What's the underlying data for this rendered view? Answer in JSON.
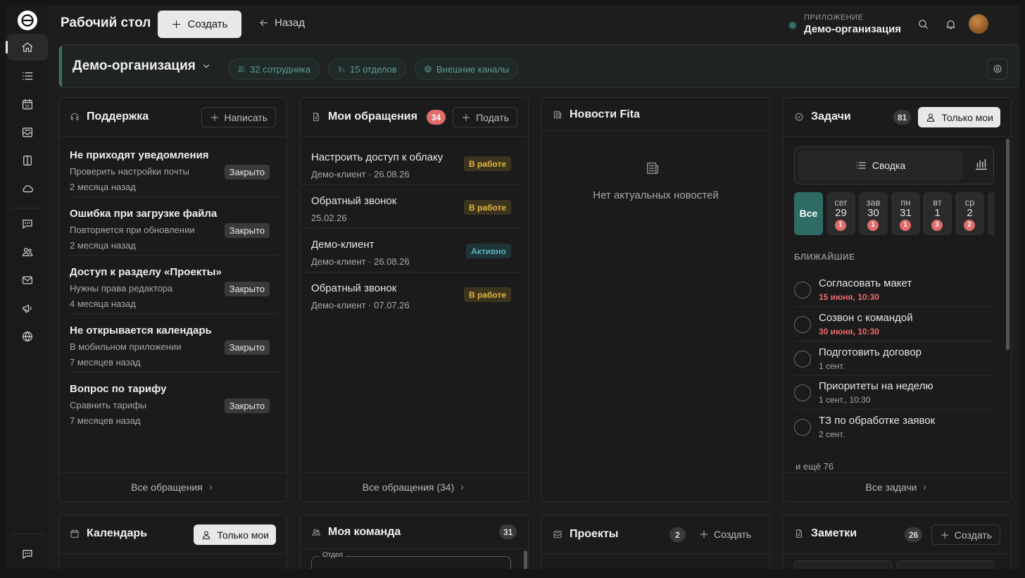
{
  "topbar": {
    "title": "Рабочий стол",
    "create_label": "Создать",
    "back_label": "Назад",
    "app_label": "ПРИЛОЖЕНИЕ",
    "app_name": "Демо-организация"
  },
  "org": {
    "title": "Демо-организация",
    "employees": "32 сотрудника",
    "departments": "15 отделов",
    "channels": "Внешние каналы"
  },
  "support": {
    "title": "Поддержка",
    "action": "Написать",
    "footer": "Все обращения",
    "items": [
      {
        "title": "Не приходят уведомления",
        "sub": "Проверить настройки почты",
        "time": "2 месяца назад",
        "status": "Закрыто"
      },
      {
        "title": "Ошибка при загрузке файла",
        "sub": "Повторяется при обновлении",
        "time": "2 месяца назад",
        "status": "Закрыто"
      },
      {
        "title": "Доступ к разделу «Проекты»",
        "sub": "Нужны права редактора",
        "time": "4 месяца назад",
        "status": "Закрыто"
      },
      {
        "title": "Не открывается календарь",
        "sub": "В мобильном приложении",
        "time": "7 месяцев назад",
        "status": "Закрыто"
      },
      {
        "title": "Вопрос по тарифу",
        "sub": "Сравнить тарифы",
        "time": "7 месяцев назад",
        "status": "Закрыто"
      }
    ]
  },
  "requests": {
    "title": "Мои обращения",
    "count": "34",
    "action": "Подать",
    "footer": "Все обращения (34)",
    "items": [
      {
        "title": "Настроить доступ к облаку",
        "sub": "Демо-клиент · 26.08.26",
        "status": "В работе"
      },
      {
        "title": "Обратный звонок",
        "sub": "25.02.26",
        "status": "В работе"
      },
      {
        "title": "Демо-клиент",
        "sub": "Демо-клиент · 26.08.26",
        "status": "Активно"
      },
      {
        "title": "Обратный звонок",
        "sub": "Демо-клиент · 07.07.26",
        "status": "В работе"
      }
    ]
  },
  "news": {
    "title": "Новости Fita",
    "empty": "Нет актуальных новостей"
  },
  "tasks": {
    "title": "Задачи",
    "count": "81",
    "filter": "Только мои",
    "summary": "Сводка",
    "all_label": "Все",
    "days": [
      {
        "name": "сег",
        "num": "29",
        "count": "1"
      },
      {
        "name": "зав",
        "num": "30",
        "count": "1"
      },
      {
        "name": "пн",
        "num": "31",
        "count": "1"
      },
      {
        "name": "вт",
        "num": "1",
        "count": "3"
      },
      {
        "name": "ср",
        "num": "2",
        "count": "2"
      }
    ],
    "section": "БЛИЖАЙШИЕ",
    "items": [
      {
        "title": "Согласовать макет",
        "date": "15 июня, 10:30"
      },
      {
        "title": "Созвон с командой",
        "date": "30 июня, 10:30"
      },
      {
        "title": "Подготовить договор",
        "date": "1 сент."
      },
      {
        "title": "Приоритеты на неделю",
        "date": "1 сент., 10:30"
      },
      {
        "title": "ТЗ по обработке заявок",
        "date": "2 сент."
      }
    ],
    "more": "и ещё 76",
    "footer": "Все задачи"
  },
  "calendar": {
    "title": "Календарь",
    "filter": "Только мои"
  },
  "team": {
    "title": "Моя команда",
    "count": "31",
    "field_label": "Отдел"
  },
  "projects": {
    "title": "Проекты",
    "count": "2",
    "action": "Создать"
  },
  "notes": {
    "title": "Заметки",
    "count": "26",
    "action": "Создать"
  }
}
